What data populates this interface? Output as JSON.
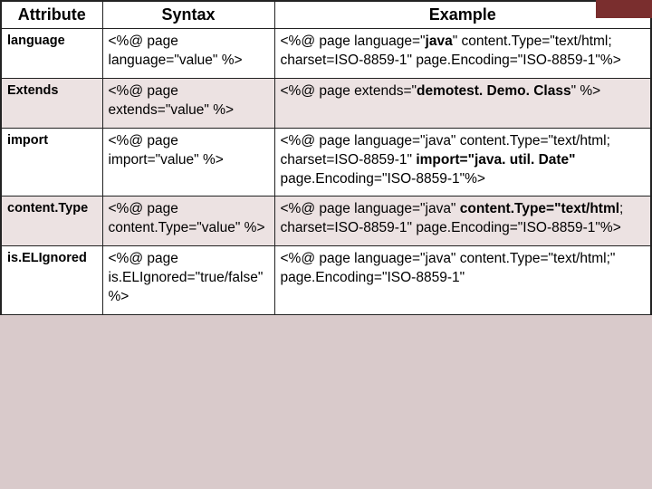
{
  "headers": {
    "attribute": "Attribute",
    "syntax": "Syntax",
    "example": "Example"
  },
  "rows": [
    {
      "attribute": "language",
      "syntax": "<%@ page language=\"value\" %>",
      "example": "<%@ page language=\"<b>java</b>\" content.Type=\"text/html; charset=ISO-8859-1\" page.Encoding=\"ISO-8859-1\"%>"
    },
    {
      "attribute": "Extends",
      "syntax": "<%@ page extends=\"value\" %>",
      "example": "<%@ page extends=\"<b>demotest. Demo. Class</b>\" %>"
    },
    {
      "attribute": "import",
      "syntax": "<%@ page import=\"value\" %>",
      "example": "<%@ page language=\"java\" content.Type=\"text/html; charset=ISO-8859-1\" <b>import=\"java. util. Date\"</b> page.Encoding=\"ISO-8859-1\"%>"
    },
    {
      "attribute": "content.Type",
      "syntax": "<%@ page content.Type=\"value\" %>",
      "example": "<%@ page language=\"java\" <b>content.Type=\"text/html</b>; charset=ISO-8859-1\" page.Encoding=\"ISO-8859-1\"%>"
    },
    {
      "attribute": "is.ELIgnored",
      "syntax": "<%@ page is.ELIgnored=\"true/false\" %>",
      "example": "<%@ page language=\"java\" content.Type=\"text/html;\" page.Encoding=\"ISO-8859-1\""
    }
  ]
}
